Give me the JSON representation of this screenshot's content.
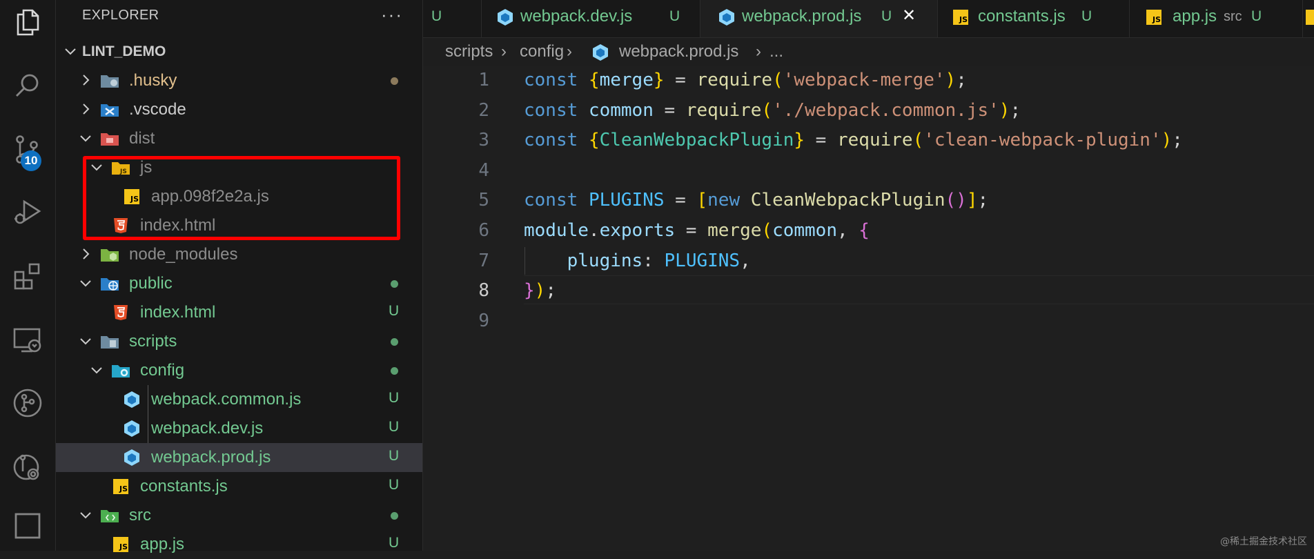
{
  "colors": {
    "untracked": "#73c991",
    "ignored": "#8c8c8c",
    "modified_dot": "#8c7a5c",
    "accent": "#0e70c0",
    "highlight_box": "#ff0000"
  },
  "activity_bar": {
    "items": [
      "files-icon",
      "search-icon",
      "source-control-icon",
      "run-debug-icon",
      "extensions-icon",
      "remote-explorer-icon",
      "git-graph-icon",
      "timeline-icon",
      "panel-icon"
    ],
    "source_control_badge": "10"
  },
  "sidebar": {
    "title": "EXPLORER",
    "more_label": "···",
    "root": "LINT_DEMO",
    "tree": [
      {
        "label": ".husky",
        "status": "",
        "dot": true
      },
      {
        "label": ".vscode",
        "status": ""
      },
      {
        "label": "dist",
        "status": ""
      },
      {
        "label": "js",
        "status": ""
      },
      {
        "label": "app.098f2e2a.js",
        "status": ""
      },
      {
        "label": "index.html",
        "status": ""
      },
      {
        "label": "node_modules",
        "status": ""
      },
      {
        "label": "public",
        "status": "",
        "dot": true
      },
      {
        "label": "index.html",
        "status": "U"
      },
      {
        "label": "scripts",
        "status": "",
        "dot": true
      },
      {
        "label": "config",
        "status": "",
        "dot": true
      },
      {
        "label": "webpack.common.js",
        "status": "U"
      },
      {
        "label": "webpack.dev.js",
        "status": "U"
      },
      {
        "label": "webpack.prod.js",
        "status": "U",
        "selected": true
      },
      {
        "label": "constants.js",
        "status": "U"
      },
      {
        "label": "src",
        "status": "",
        "dot": true
      },
      {
        "label": "app.js",
        "status": "U"
      }
    ]
  },
  "tabs": [
    {
      "label": "",
      "status": "U"
    },
    {
      "label": "webpack.dev.js",
      "status": "U"
    },
    {
      "label": "webpack.prod.js",
      "status": "U",
      "active": true
    },
    {
      "label": "constants.js",
      "status": "U"
    },
    {
      "label": "app.js",
      "description": "src",
      "status": "U"
    }
  ],
  "close_label": "✕",
  "breadcrumb": {
    "parts": [
      "scripts",
      "config",
      "webpack.prod.js",
      "..."
    ],
    "sep": "›"
  },
  "editor": {
    "line_numbers": [
      "1",
      "2",
      "3",
      "4",
      "5",
      "6",
      "7",
      "8",
      "9"
    ],
    "current_line": 8,
    "lines": [
      [
        [
          "kw",
          "const"
        ],
        [
          "plain",
          " "
        ],
        [
          "b1",
          "{"
        ],
        [
          "var",
          "merge"
        ],
        [
          "b1",
          "}"
        ],
        [
          "plain",
          " = "
        ],
        [
          "fn",
          "require"
        ],
        [
          "b1",
          "("
        ],
        [
          "str",
          "'webpack-merge'"
        ],
        [
          "b1",
          ")"
        ],
        [
          "plain",
          ";"
        ]
      ],
      [
        [
          "kw",
          "const"
        ],
        [
          "plain",
          " "
        ],
        [
          "var",
          "common"
        ],
        [
          "plain",
          " = "
        ],
        [
          "fn",
          "require"
        ],
        [
          "b1",
          "("
        ],
        [
          "str",
          "'./webpack.common.js'"
        ],
        [
          "b1",
          ")"
        ],
        [
          "plain",
          ";"
        ]
      ],
      [
        [
          "kw",
          "const"
        ],
        [
          "plain",
          " "
        ],
        [
          "b1",
          "{"
        ],
        [
          "cls",
          "CleanWebpackPlugin"
        ],
        [
          "b1",
          "}"
        ],
        [
          "plain",
          " = "
        ],
        [
          "fn",
          "require"
        ],
        [
          "b1",
          "("
        ],
        [
          "str",
          "'clean-webpack-plugin'"
        ],
        [
          "b1",
          ")"
        ],
        [
          "plain",
          ";"
        ]
      ],
      [],
      [
        [
          "kw",
          "const"
        ],
        [
          "plain",
          " "
        ],
        [
          "const",
          "PLUGINS"
        ],
        [
          "plain",
          " = "
        ],
        [
          "b1",
          "["
        ],
        [
          "kw",
          "new"
        ],
        [
          "plain",
          " "
        ],
        [
          "fn",
          "CleanWebpackPlugin"
        ],
        [
          "b2",
          "()"
        ],
        [
          "b1",
          "]"
        ],
        [
          "plain",
          ";"
        ]
      ],
      [
        [
          "var",
          "module"
        ],
        [
          "plain",
          "."
        ],
        [
          "var",
          "exports"
        ],
        [
          "plain",
          " = "
        ],
        [
          "fn",
          "merge"
        ],
        [
          "b1",
          "("
        ],
        [
          "var",
          "common"
        ],
        [
          "plain",
          ", "
        ],
        [
          "b2",
          "{"
        ]
      ],
      [
        [
          "plain",
          "    "
        ],
        [
          "var",
          "plugins"
        ],
        [
          "plain",
          ": "
        ],
        [
          "const",
          "PLUGINS"
        ],
        [
          "plain",
          ","
        ]
      ],
      [
        [
          "b2",
          "}"
        ],
        [
          "b1",
          ")"
        ],
        [
          "plain",
          ";"
        ]
      ],
      []
    ]
  },
  "watermark": "@稀土掘金技术社区"
}
